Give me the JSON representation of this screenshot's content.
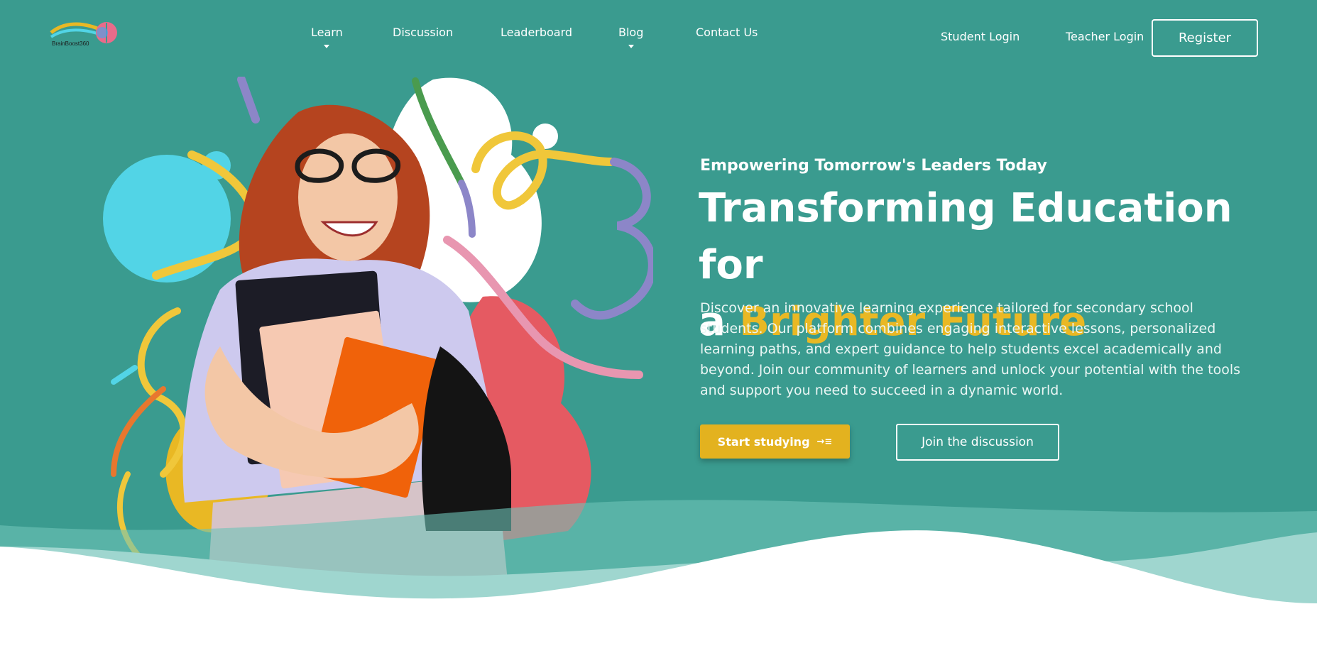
{
  "brand": {
    "logo_text": "BrainBoost360",
    "logo_icon": "brain-icon"
  },
  "nav": {
    "items": [
      {
        "label": "Learn",
        "has_dropdown": true
      },
      {
        "label": "Discussion",
        "has_dropdown": false
      },
      {
        "label": "Leaderboard",
        "has_dropdown": false
      },
      {
        "label": "Blog",
        "has_dropdown": true
      },
      {
        "label": "Contact Us",
        "has_dropdown": false
      }
    ],
    "student_login": "Student Login",
    "teacher_login": "Teacher Login",
    "register": "Register"
  },
  "hero": {
    "eyebrow": "Empowering Tomorrow's Leaders Today",
    "headline_line1": "Transforming Education for",
    "headline_a": "a ",
    "headline_accent": "Brighter Future",
    "description": "Discover an innovative learning experience tailored for secondary school students. Our platform combines engaging interactive lessons, personalized learning paths, and expert guidance to help students excel academically and beyond. Join our community of learners and unlock your potential with the tools and support you need to succeed in a dynamic world.",
    "primary_button": "Start studying",
    "primary_button_icon": "arrow-right-icon",
    "secondary_button": "Join the discussion"
  },
  "colors": {
    "background": "#3a9b8f",
    "accent": "#e9b824",
    "button_primary": "#e3b21f",
    "text": "#ffffff"
  }
}
